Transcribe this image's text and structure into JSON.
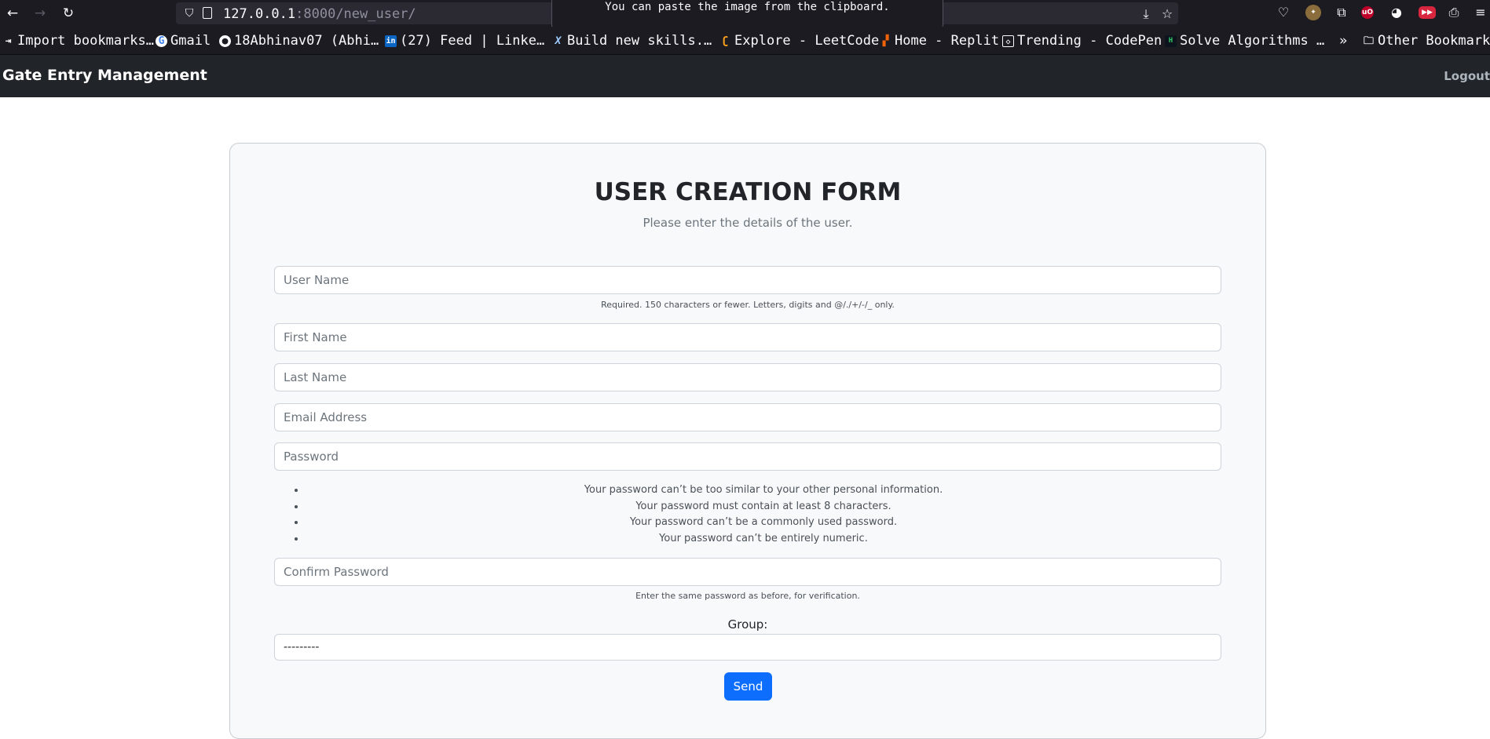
{
  "browser": {
    "url_host": "127.0.0.1",
    "url_port": ":8000",
    "url_path": "/new_user/",
    "tooltip": "You can paste the image from the clipboard."
  },
  "bookmarks": [
    {
      "label": "Import bookmarks…",
      "icon": "import-icon"
    },
    {
      "label": "Gmail",
      "icon": "google-icon"
    },
    {
      "label": "18Abhinav07 (Abhi…",
      "icon": "github-icon"
    },
    {
      "label": "(27) Feed | Linke…",
      "icon": "linkedin-icon"
    },
    {
      "label": "Build new skills.…",
      "icon": "x-icon"
    },
    {
      "label": "Explore - LeetCode",
      "icon": "leetcode-icon"
    },
    {
      "label": "Home - Replit",
      "icon": "replit-icon"
    },
    {
      "label": "Trending - CodePen",
      "icon": "codepen-icon"
    },
    {
      "label": "Solve Algorithms …",
      "icon": "hackerrank-icon"
    },
    {
      "label": "Other Bookmarks",
      "icon": "folder-icon"
    }
  ],
  "app": {
    "brand": "Gate Entry Management",
    "logout": "Logout"
  },
  "form": {
    "title": "USER CREATION FORM",
    "subtitle": "Please enter the details of the user.",
    "username_placeholder": "User Name",
    "username_help": "Required. 150 characters or fewer. Letters, digits and @/./+/-/_ only.",
    "first_name_placeholder": "First Name",
    "last_name_placeholder": "Last Name",
    "email_placeholder": "Email Address",
    "password_placeholder": "Password",
    "password_rules": [
      "Your password can’t be too similar to your other personal information.",
      "Your password must contain at least 8 characters.",
      "Your password can’t be a commonly used password.",
      "Your password can’t be entirely numeric."
    ],
    "confirm_placeholder": "Confirm Password",
    "confirm_help": "Enter the same password as before, for verification.",
    "group_label": "Group:",
    "group_selected": "---------",
    "send_label": "Send"
  },
  "colors": {
    "navbar_bg": "#212529",
    "card_bg": "#f8f9fa",
    "primary": "#0d6efd"
  }
}
